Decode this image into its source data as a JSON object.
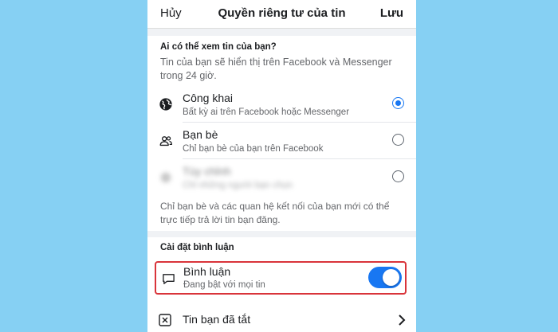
{
  "header": {
    "cancel_label": "Hủy",
    "title": "Quyền riêng tư của tin",
    "save_label": "Lưu"
  },
  "audience": {
    "heading": "Ai có thể xem tin của bạn?",
    "description": "Tin của bạn sẽ hiển thị trên Facebook và Messenger trong 24 giờ.",
    "options": [
      {
        "title": "Công khai",
        "subtitle": "Bất kỳ ai trên Facebook hoặc Messenger",
        "selected": true,
        "icon": "globe-icon"
      },
      {
        "title": "Bạn bè",
        "subtitle": "Chỉ bạn bè của bạn trên Facebook",
        "selected": false,
        "icon": "friends-icon"
      },
      {
        "title": "Tùy chỉnh",
        "subtitle": "Chỉ những người bạn chọn",
        "selected": false,
        "icon": "gear-icon"
      }
    ],
    "footnote": "Chỉ bạn bè và các quan hệ kết nối của bạn mới có thể trực tiếp trả lời tin bạn đăng."
  },
  "comments": {
    "heading": "Cài đặt bình luận",
    "title": "Bình luận",
    "subtitle": "Đang bật với mọi tin",
    "enabled": true,
    "icon": "comment-icon"
  },
  "muted": {
    "title": "Tin bạn đã tắt",
    "icon": "muted-story-icon"
  },
  "colors": {
    "background": "#86d0f3",
    "accent": "#1877f2",
    "highlight_border": "#d9343a"
  }
}
